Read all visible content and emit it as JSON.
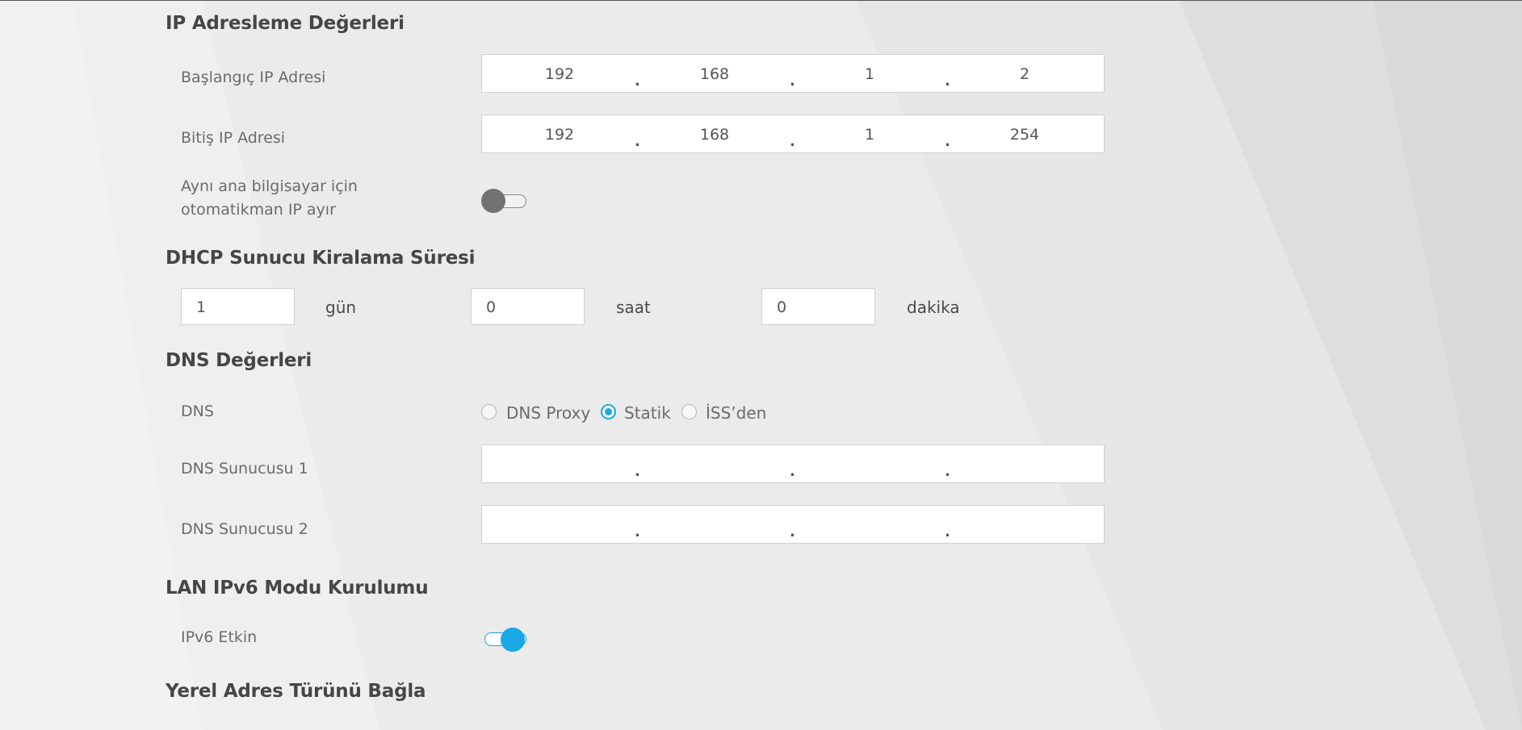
{
  "colors": {
    "accent": "#18a9e6",
    "background": "#ebebeb",
    "input_background": "#ffffff",
    "toggle_off": "#727272"
  },
  "ip_addressing": {
    "title": "IP Adresleme Değerleri",
    "start_ip": {
      "label": "Başlangıç IP Adresi",
      "octets": [
        "192",
        "168",
        "1",
        "2"
      ]
    },
    "end_ip": {
      "label": "Bitiş IP Adresi",
      "octets": [
        "192",
        "168",
        "1",
        "254"
      ]
    },
    "auto_reserve": {
      "label": "Aynı ana bilgisayar için otomatikman IP ayır",
      "enabled": false
    }
  },
  "lease_time": {
    "title": "DHCP Sunucu Kiralama Süresi",
    "days": {
      "value": "1",
      "unit": "gün"
    },
    "hours": {
      "value": "0",
      "unit": "saat"
    },
    "minutes": {
      "value": "0",
      "unit": "dakika"
    }
  },
  "dns": {
    "title": "DNS Değerleri",
    "mode_label": "DNS",
    "options": [
      {
        "label": "DNS Proxy",
        "selected": false
      },
      {
        "label": "Statik",
        "selected": true
      },
      {
        "label": "İSS’den",
        "selected": false
      }
    ],
    "server1": {
      "label": "DNS Sunucusu 1",
      "octets": [
        "",
        "",
        "",
        ""
      ]
    },
    "server2": {
      "label": "DNS Sunucusu 2",
      "octets": [
        "",
        "",
        "",
        ""
      ]
    }
  },
  "ipv6": {
    "title": "LAN IPv6 Modu Kurulumu",
    "enable_label": "IPv6 Etkin",
    "enabled": true
  },
  "local_address": {
    "title": "Yerel Adres Türünü Bağla"
  }
}
